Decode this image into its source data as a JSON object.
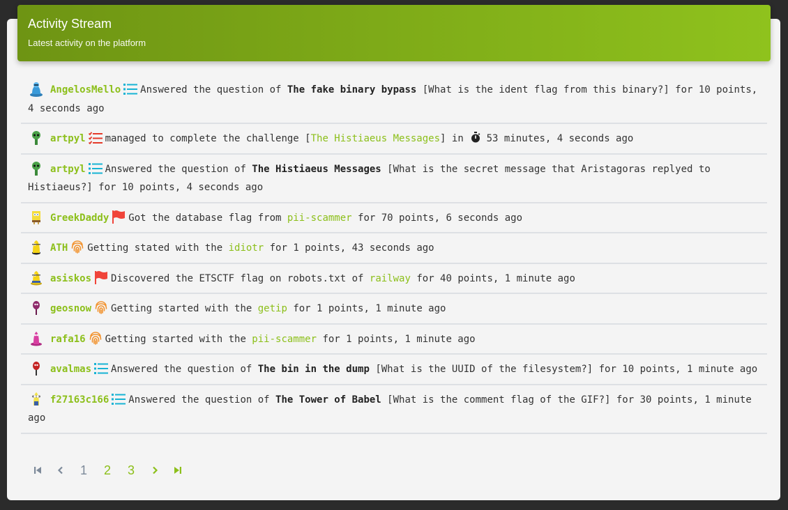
{
  "header": {
    "title": "Activity Stream",
    "subtitle": "Latest activity on the platform"
  },
  "colors": {
    "accent": "#8cbf1a",
    "list_icon": "#17b3d4",
    "checklist_icon": "#e53a2a",
    "flag_icon": "#f0443a",
    "fingerprint_icon": "#f2922d"
  },
  "items": [
    {
      "user": "AngelosMello",
      "icon": "list-icon",
      "t1": "Answered the question of ",
      "b1": "The fake binary bypass",
      "t2": " [What is the ident flag from this binary?] for 10 points, 4 seconds ago"
    },
    {
      "user": "artpyl",
      "icon": "checklist-icon",
      "t1": "managed to complete the challenge [",
      "link": "The Histiaeus Messages",
      "t2": "] in ",
      "t3": " 53 minutes, 4 seconds ago"
    },
    {
      "user": "artpyl",
      "icon": "list-icon",
      "t1": "Answered the question of ",
      "b1": "The Histiaeus Messages",
      "t2": " [What is the secret message that Aristagoras replyed to Histiaeus?] for 10 points, 4 seconds ago"
    },
    {
      "user": "GreekDaddy",
      "icon": "flag-icon",
      "t1": "Got the database flag from ",
      "link": "pii-scammer",
      "t2": " for 70 points, 6 seconds ago"
    },
    {
      "user": "ATH",
      "icon": "fingerprint-icon",
      "t1": "Getting stated with the ",
      "link": "idiotr",
      "t2": " for 1 points, 43 seconds ago"
    },
    {
      "user": "asiskos",
      "icon": "flag-icon",
      "t1": "Discovered the ETSCTF flag on robots.txt of ",
      "link": "railway",
      "t2": " for 40 points, 1 minute ago"
    },
    {
      "user": "geosnow",
      "icon": "fingerprint-icon",
      "t1": "Getting started with the ",
      "link": "getip",
      "t2": " for 1 points, 1 minute ago"
    },
    {
      "user": "rafa16",
      "icon": "fingerprint-icon",
      "t1": "Getting started with the ",
      "link": "pii-scammer",
      "t2": " for 1 points, 1 minute ago"
    },
    {
      "user": "avalmas",
      "icon": "list-icon",
      "t1": "Answered the question of ",
      "b1": "The bin in the dump",
      "t2": " [What is the UUID of the filesystem?] for 10 points, 1 minute ago"
    },
    {
      "user": "f27163c166",
      "icon": "list-icon",
      "t1": "Answered the question of ",
      "b1": "The Tower of Babel",
      "t2": " [What is the comment flag of the GIF?] for 30 points, 1 minute ago"
    }
  ],
  "pagination": {
    "first_icon": "first-page-icon",
    "prev_icon": "chevron-left-icon",
    "pages": [
      "1",
      "2",
      "3"
    ],
    "next_icon": "chevron-right-icon",
    "last_icon": "last-page-icon"
  }
}
